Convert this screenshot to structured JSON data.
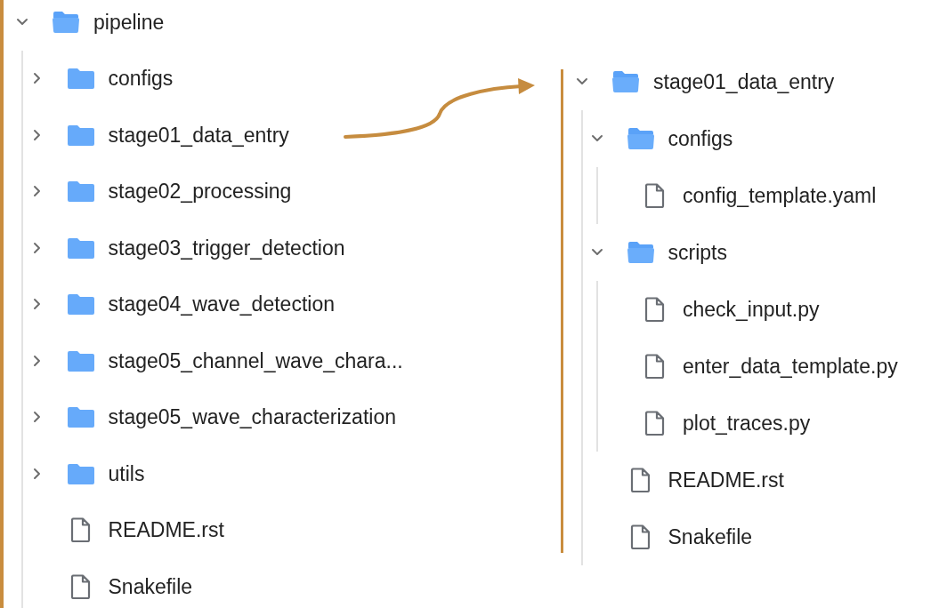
{
  "trees": [
    {
      "root": {
        "kind": "folder",
        "name": "pipeline",
        "expanded": true,
        "children": [
          {
            "kind": "folder",
            "name": "configs",
            "expanded": false
          },
          {
            "kind": "folder",
            "name": "stage01_data_entry",
            "expanded": false
          },
          {
            "kind": "folder",
            "name": "stage02_processing",
            "expanded": false
          },
          {
            "kind": "folder",
            "name": "stage03_trigger_detection",
            "expanded": false
          },
          {
            "kind": "folder",
            "name": "stage04_wave_detection",
            "expanded": false
          },
          {
            "kind": "folder",
            "name": "stage05_channel_wave_chara...",
            "expanded": false
          },
          {
            "kind": "folder",
            "name": "stage05_wave_characterization",
            "expanded": false
          },
          {
            "kind": "folder",
            "name": "utils",
            "expanded": false
          },
          {
            "kind": "file",
            "name": "README.rst"
          },
          {
            "kind": "file",
            "name": "Snakefile"
          }
        ]
      }
    },
    {
      "root": {
        "kind": "folder",
        "name": "stage01_data_entry",
        "expanded": true,
        "children": [
          {
            "kind": "folder",
            "name": "configs",
            "expanded": true,
            "children": [
              {
                "kind": "file",
                "name": "config_template.yaml"
              }
            ]
          },
          {
            "kind": "folder",
            "name": "scripts",
            "expanded": true,
            "children": [
              {
                "kind": "file",
                "name": "check_input.py"
              },
              {
                "kind": "file",
                "name": "enter_data_template.py"
              },
              {
                "kind": "file",
                "name": "plot_traces.py"
              }
            ]
          },
          {
            "kind": "file",
            "name": "README.rst"
          },
          {
            "kind": "file",
            "name": "Snakefile"
          }
        ]
      }
    }
  ]
}
